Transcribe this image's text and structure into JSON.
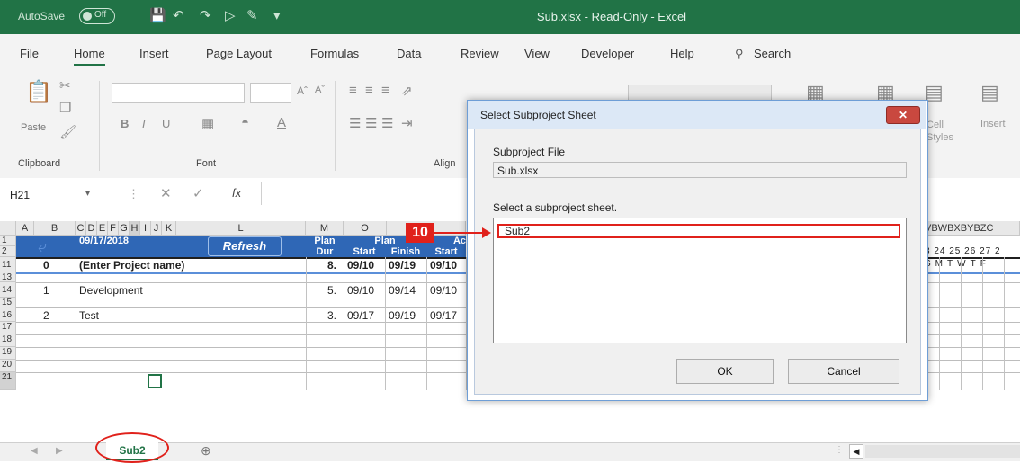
{
  "window": {
    "autosave_label": "AutoSave",
    "autosave_state": "Off",
    "title": "Sub.xlsx - Read-Only - Excel"
  },
  "ribbon": {
    "tabs": [
      "File",
      "Home",
      "Insert",
      "Page Layout",
      "Formulas",
      "Data",
      "Review",
      "View",
      "Developer",
      "Help"
    ],
    "active_tab": "Home",
    "search_label": "Search",
    "paste_label": "Paste",
    "groups": {
      "clipboard": "Clipboard",
      "font": "Font",
      "alignment": "Align",
      "cell_styles": "Cell Styles",
      "insert": "Insert"
    },
    "font_buttons": {
      "bold": "B",
      "italic": "I",
      "underline": "U"
    }
  },
  "formula_bar": {
    "name_box": "H21",
    "fx": "fx",
    "value": ""
  },
  "sheet": {
    "columns": [
      "A",
      "B",
      "C",
      "D",
      "E",
      "F",
      "G",
      "H",
      "I",
      "J",
      "K",
      "L",
      "M",
      "O"
    ],
    "right_columns": [
      "V",
      "BW",
      "BX",
      "BY",
      "BZ",
      "C"
    ],
    "date": "09/17/2018",
    "refresh_label": "Refresh",
    "headers": {
      "plan_dur_1": "Plan",
      "plan_dur_2": "Dur",
      "plan": "Plan",
      "start": "Start",
      "finish": "Finish",
      "actual_start_1": "Ac",
      "actual_start_2": "Start"
    },
    "day_numbers": [
      "3",
      "24",
      "25",
      "26",
      "27",
      "2"
    ],
    "day_letters": [
      "S",
      "M",
      "T",
      "W",
      "T",
      "F"
    ],
    "rows": [
      {
        "num": "1",
        "id": "",
        "name": "",
        "dur": "",
        "start": "",
        "finish": "",
        "astart": ""
      },
      {
        "num": "2",
        "id": "",
        "name": "",
        "dur": "",
        "start": "",
        "finish": "",
        "astart": ""
      },
      {
        "num": "11",
        "id": "0",
        "name": "(Enter Project name)",
        "dur": "8.",
        "start": "09/10",
        "finish": "09/19",
        "astart": "09/10"
      },
      {
        "num": "13",
        "id": "",
        "name": "",
        "dur": "",
        "start": "",
        "finish": "",
        "astart": ""
      },
      {
        "num": "14",
        "id": "1",
        "name": "Development",
        "dur": "5.",
        "start": "09/10",
        "finish": "09/14",
        "astart": "09/10"
      },
      {
        "num": "15",
        "id": "",
        "name": "",
        "dur": "",
        "start": "",
        "finish": "",
        "astart": ""
      },
      {
        "num": "16",
        "id": "2",
        "name": "Test",
        "dur": "3.",
        "start": "09/17",
        "finish": "09/19",
        "astart": "09/17"
      },
      {
        "num": "17"
      },
      {
        "num": "18"
      },
      {
        "num": "19"
      },
      {
        "num": "20"
      },
      {
        "num": "21"
      }
    ],
    "active_tab": "Sub2"
  },
  "annotation": {
    "step": "10"
  },
  "dialog": {
    "title": "Select Subproject Sheet",
    "file_label": "Subproject File",
    "file_value": "Sub.xlsx",
    "sheet_label": "Select a subproject sheet.",
    "sheets": [
      "Sub2"
    ],
    "ok_label": "OK",
    "cancel_label": "Cancel"
  },
  "colors": {
    "excel_green": "#217346",
    "header_blue": "#2f67b6",
    "annotation_red": "#e0211b"
  }
}
